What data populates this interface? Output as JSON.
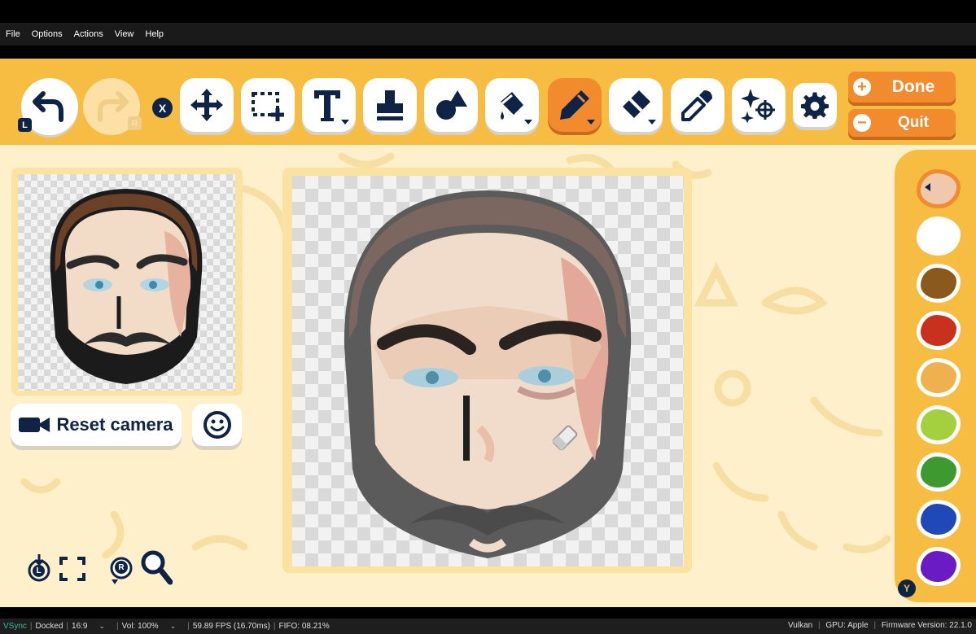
{
  "menubar": {
    "items": [
      "File",
      "Options",
      "Actions",
      "View",
      "Help"
    ]
  },
  "toolbar": {
    "undo_hint": "L",
    "redo_hint": "R",
    "clear_hint": "X",
    "tools": [
      {
        "name": "move",
        "icon": "move-arrows-icon"
      },
      {
        "name": "select",
        "icon": "rect-select-icon"
      },
      {
        "name": "text",
        "icon": "text-icon"
      },
      {
        "name": "stamp",
        "icon": "stamp-icon"
      },
      {
        "name": "shapes",
        "icon": "shapes-icon"
      },
      {
        "name": "fill",
        "icon": "paint-bucket-icon"
      },
      {
        "name": "pencil",
        "icon": "pencil-icon",
        "active": true
      },
      {
        "name": "eraser",
        "icon": "eraser-icon"
      },
      {
        "name": "eyedropper",
        "icon": "eyedropper-icon"
      },
      {
        "name": "sparkle",
        "icon": "sparkle-target-icon"
      },
      {
        "name": "settings",
        "icon": "gear-icon"
      }
    ],
    "done_label": "Done",
    "quit_label": "Quit"
  },
  "preview": {
    "reset_camera_label": "Reset camera"
  },
  "palette": {
    "selected_index": 0,
    "colors": [
      "#f0c9ad",
      "#ffffff",
      "#8a5a1c",
      "#c9311f",
      "#eeb14e",
      "#a4cf3f",
      "#3e9a30",
      "#1f48b8",
      "#6a1bc4"
    ],
    "hint": "Y"
  },
  "bottom_controls": {
    "left_hint": "L",
    "right_hint": "R"
  },
  "accent": "#f28a2e",
  "toolbar_bg": "#f6bd42",
  "statusbar": {
    "vsync": "VSync",
    "docked": "Docked",
    "aspect": "16:9",
    "volume": "Vol: 100%",
    "fps": "59.89 FPS (16.70ms)",
    "fifo": "FIFO: 08.21%",
    "backend": "Vulkan",
    "gpu": "GPU: Apple",
    "firmware": "Firmware Version: 22.1.0"
  }
}
